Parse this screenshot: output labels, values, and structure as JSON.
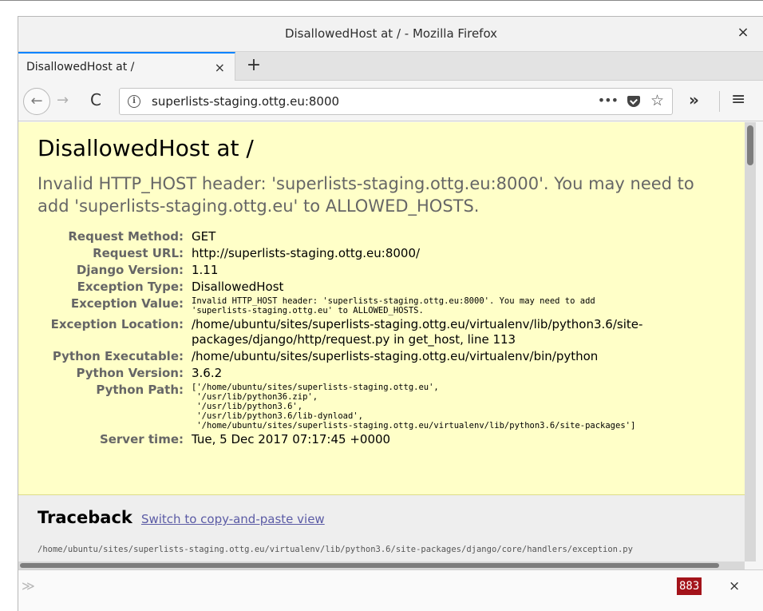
{
  "window": {
    "title": "DisallowedHost at / - Mozilla Firefox",
    "close_glyph": "×"
  },
  "tabs": [
    {
      "label": "DisallowedHost at /",
      "close_glyph": "×"
    }
  ],
  "new_tab_glyph": "+",
  "nav": {
    "back_glyph": "←",
    "forward_glyph": "→",
    "reload_glyph": "C",
    "url": "superlists-staging.ottg.eu:8000",
    "more_glyph": "•••",
    "star_glyph": "☆",
    "overflow_glyph": "»",
    "menu_glyph": "≡",
    "icons": [
      "info-icon",
      "pocket-icon",
      "star-icon",
      "hamburger-menu-icon"
    ]
  },
  "summary": {
    "title": "DisallowedHost at /",
    "message": "Invalid HTTP_HOST header: 'superlists-staging.ottg.eu:8000'. You may need to add 'superlists-staging.ottg.eu' to ALLOWED_HOSTS.",
    "rows": [
      {
        "label": "Request Method:",
        "value": "GET"
      },
      {
        "label": "Request URL:",
        "value": "http://superlists-staging.ottg.eu:8000/"
      },
      {
        "label": "Django Version:",
        "value": "1.11"
      },
      {
        "label": "Exception Type:",
        "value": "DisallowedHost"
      },
      {
        "label": "Exception Value:",
        "value": "Invalid HTTP_HOST header: 'superlists-staging.ottg.eu:8000'. You may need to add\n'superlists-staging.ottg.eu' to ALLOWED_HOSTS."
      },
      {
        "label": "Exception Location:",
        "value": "/home/ubuntu/sites/superlists-staging.ottg.eu/virtualenv/lib/python3.6/site-packages/django/http/request.py in get_host, line 113"
      },
      {
        "label": "Python Executable:",
        "value": "/home/ubuntu/sites/superlists-staging.ottg.eu/virtualenv/bin/python"
      },
      {
        "label": "Python Version:",
        "value": "3.6.2"
      },
      {
        "label": "Python Path:",
        "value": "['/home/ubuntu/sites/superlists-staging.ottg.eu',\n '/usr/lib/python36.zip',\n '/usr/lib/python3.6',\n '/usr/lib/python3.6/lib-dynload',\n '/home/ubuntu/sites/superlists-staging.ottg.eu/virtualenv/lib/python3.6/site-packages']"
      },
      {
        "label": "Server time:",
        "value": "Tue, 5 Dec 2017 07:17:45 +0000"
      }
    ]
  },
  "traceback": {
    "title": "Traceback",
    "switch_link": "Switch to copy-and-paste view",
    "first_path": "/home/ubuntu/sites/superlists-staging.ottg.eu/virtualenv/lib/python3.6/site-packages/django/core/handlers/exception.py"
  },
  "bottombar": {
    "chevron_glyph": "≫",
    "badge": "883",
    "close_glyph": "×",
    "badge_color": "#a3131a"
  }
}
